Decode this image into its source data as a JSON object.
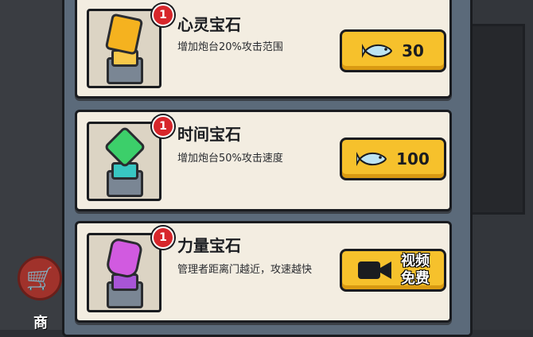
{
  "shop": {
    "label": "商"
  },
  "items": [
    {
      "title": "心灵宝石",
      "desc": "增加炮台20%攻击范围",
      "badge": "1",
      "price": "30",
      "action": "buy",
      "gem": "gold-gem-icon"
    },
    {
      "title": "时间宝石",
      "desc": "增加炮台50%攻击速度",
      "badge": "1",
      "price": "100",
      "action": "buy",
      "gem": "green-gem-icon"
    },
    {
      "title": "力量宝石",
      "desc": "管理者距离门越近，攻速越快",
      "badge": "1",
      "price": "",
      "action": "video",
      "video_line1": "视频",
      "video_line2": "免费",
      "gem": "purple-gem-icon"
    }
  ],
  "colors": {
    "button": "#f6c12c",
    "badge": "#d7262b",
    "card": "#f3ede1"
  }
}
